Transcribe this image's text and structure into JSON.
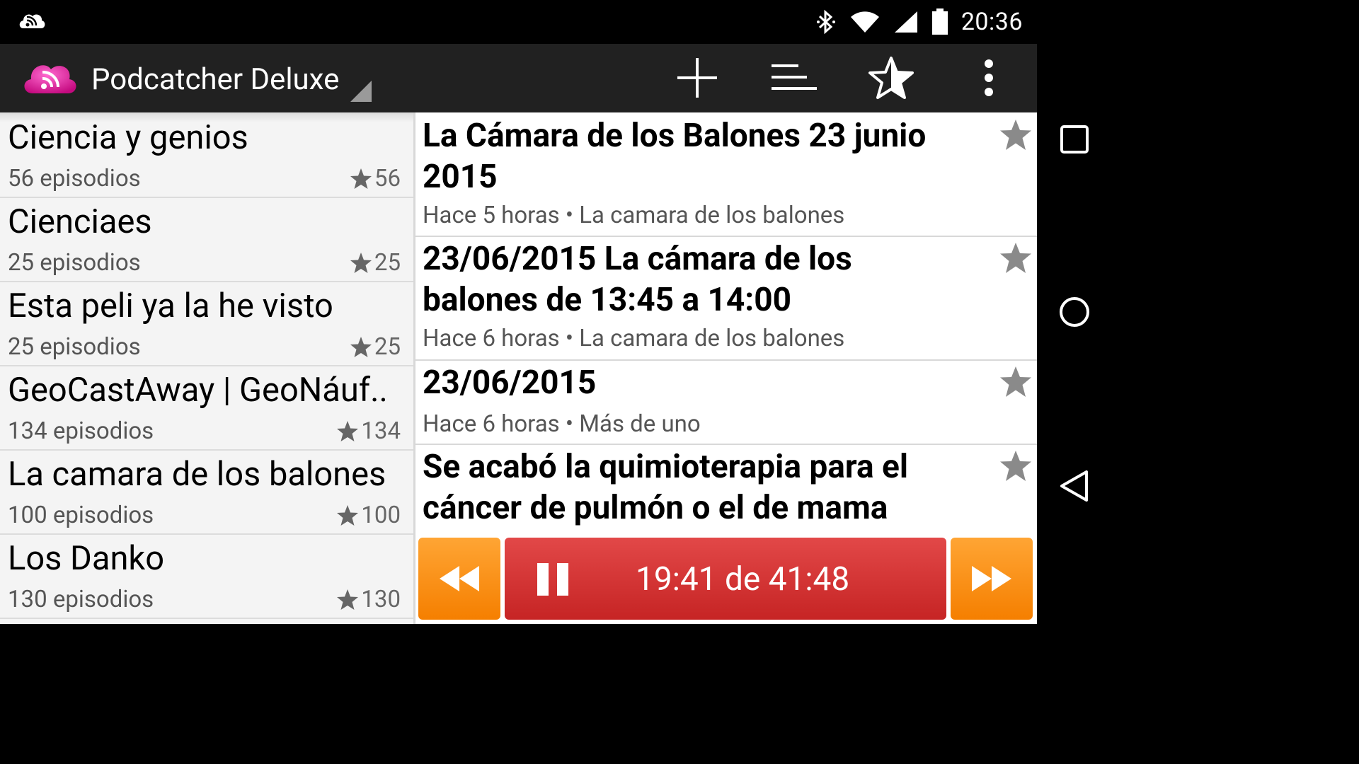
{
  "status_bar": {
    "time": "20:36",
    "icons": [
      "podcast-notification-icon",
      "bluetooth-icon",
      "wifi-icon",
      "signal-icon",
      "battery-icon"
    ]
  },
  "action_bar": {
    "app_title": "Podcatcher Deluxe",
    "actions": [
      "add-icon",
      "sort-icon",
      "favorite-star-icon",
      "overflow-menu-icon"
    ]
  },
  "podcasts": [
    {
      "name": "Ciencia y genios",
      "episodes": "56 episodios",
      "favorites": "56"
    },
    {
      "name": "Cienciaes",
      "episodes": "25 episodios",
      "favorites": "25"
    },
    {
      "name": "Esta peli ya la he visto",
      "episodes": "25 episodios",
      "favorites": "25"
    },
    {
      "name": "GeoCastAway | GeoNáuf..",
      "episodes": "134 episodios",
      "favorites": "134"
    },
    {
      "name": "La camara de los balones",
      "episodes": "100 episodios",
      "favorites": "100"
    },
    {
      "name": "Los Danko",
      "episodes": "130 episodios",
      "favorites": "130"
    }
  ],
  "episodes": [
    {
      "title": "La Cámara de los Balones 23 junio 2015",
      "meta": "Hace 5 horas • La camara de los balones"
    },
    {
      "title": "23/06/2015 La cámara de los balones de 13:45 a 14:00",
      "meta": "Hace 6 horas • La camara de los balones"
    },
    {
      "title": "23/06/2015",
      "meta": "Hace 6 horas • Más de uno"
    },
    {
      "title": "Se acabó la quimioterapia para el cáncer de pulmón o el de mama",
      "meta": ""
    }
  ],
  "player": {
    "time_label": "19:41 de 41:48"
  },
  "colors": {
    "accent_orange": "#f57f00",
    "player_red": "#c62424",
    "action_bar": "#212121",
    "logo_pink": "#e0108f"
  }
}
